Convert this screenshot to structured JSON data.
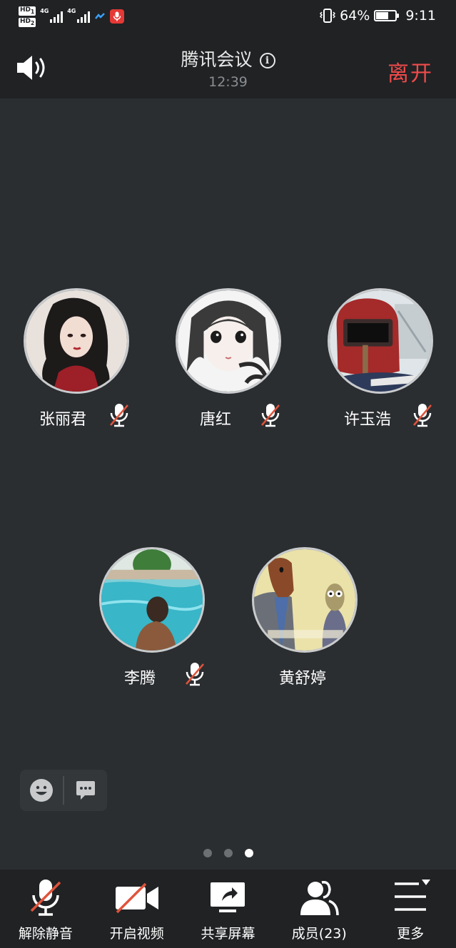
{
  "status_bar": {
    "hd1": "HD",
    "hd1_sub": "1",
    "hd2": "HD",
    "hd2_sub": "2",
    "network1": "4G",
    "network2": "4G",
    "battery_percent": "64%",
    "battery_level": 0.64,
    "time": "9:11"
  },
  "header": {
    "title": "腾讯会议",
    "timer": "12:39",
    "leave_label": "离开",
    "icons": {
      "speaker": "speaker-icon",
      "info": "info-icon"
    }
  },
  "participants": [
    {
      "name": "张丽君",
      "muted": true,
      "avatar": "anime-woman-dark-hair"
    },
    {
      "name": "唐红",
      "muted": true,
      "avatar": "anime-girl-sketch"
    },
    {
      "name": "许玉浩",
      "muted": true,
      "avatar": "welding-mask"
    },
    {
      "name": "李腾",
      "muted": true,
      "avatar": "man-in-pool"
    },
    {
      "name": "黄舒婷",
      "muted": false,
      "avatar": "cartoon-horse-owl"
    }
  ],
  "quick_actions": {
    "emoji": "emoji-icon",
    "chat": "chat-icon"
  },
  "pagination": {
    "total": 3,
    "active": 3
  },
  "toolbar": {
    "unmute_label": "解除静音",
    "video_label": "开启视频",
    "share_label": "共享屏幕",
    "members_label": "成员(23)",
    "more_label": "更多"
  },
  "colors": {
    "background": "#2b2e31",
    "bar": "#202224",
    "leave": "#f04b4b",
    "mute_slash": "#e0533b"
  }
}
